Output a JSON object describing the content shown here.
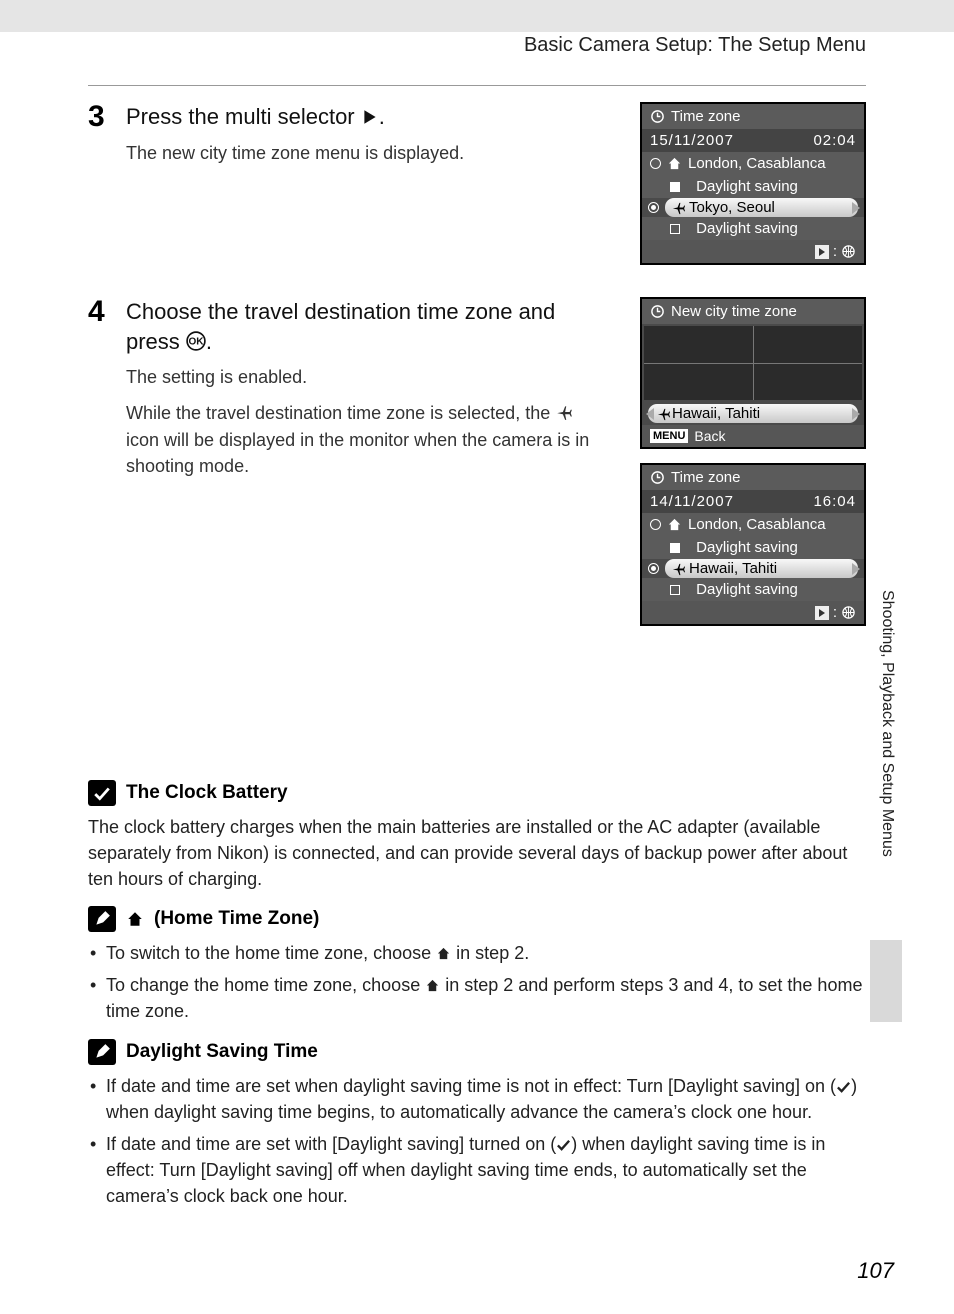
{
  "running_head": "Basic Camera Setup: The Setup Menu",
  "side_tab": "Shooting, Playback and Setup Menus",
  "page_number": "107",
  "step3": {
    "num": "3",
    "head_a": "Press the multi selector ",
    "head_b": ".",
    "body": "The new city time zone menu is displayed.",
    "lcd": {
      "title": "Time zone",
      "date": "15/11/2007",
      "time": "02:04",
      "home": "London, Casablanca",
      "home_ds": "Daylight saving",
      "dest": "Tokyo, Seoul",
      "dest_ds": "Daylight saving"
    }
  },
  "step4": {
    "num": "4",
    "head": "Choose the travel destination time zone and press ",
    "head_b": ".",
    "body1": "The setting is enabled.",
    "body2a": "While the travel destination time zone is selected, the ",
    "body2b": " icon will be displayed in the monitor when the camera is in shooting mode.",
    "lcd_map": {
      "title": "New city time zone",
      "dest": "Hawaii, Tahiti",
      "back": "Back"
    },
    "lcd_tz": {
      "title": "Time zone",
      "date": "14/11/2007",
      "time": "16:04",
      "home": "London, Casablanca",
      "home_ds": "Daylight saving",
      "dest": "Hawaii, Tahiti",
      "dest_ds": "Daylight saving"
    }
  },
  "notes": {
    "clock": {
      "title": "The Clock Battery",
      "body": "The clock battery charges when the main batteries are installed or the AC adapter (available separately from Nikon) is connected, and can provide several days of backup power after about ten hours of charging."
    },
    "home": {
      "title": " (Home Time Zone)",
      "b1a": "To switch to the home time zone, choose ",
      "b1b": " in step 2.",
      "b2a": "To change the home time zone, choose ",
      "b2b": " in step 2 and perform steps 3 and 4, to set the home time zone."
    },
    "dst": {
      "title": "Daylight Saving Time",
      "b1a": "If date and time are set when daylight saving time is not in effect: Turn [Daylight saving] on (",
      "b1b": ") when daylight saving time begins, to automatically advance the camera’s clock one hour.",
      "b2a": "If date and time are set with [Daylight saving] turned on (",
      "b2b": ") when daylight saving time is in effect: Turn [Daylight saving] off when daylight saving time ends, to automatically set the camera’s clock back one hour."
    }
  },
  "icons": {
    "menu": "MENU"
  }
}
